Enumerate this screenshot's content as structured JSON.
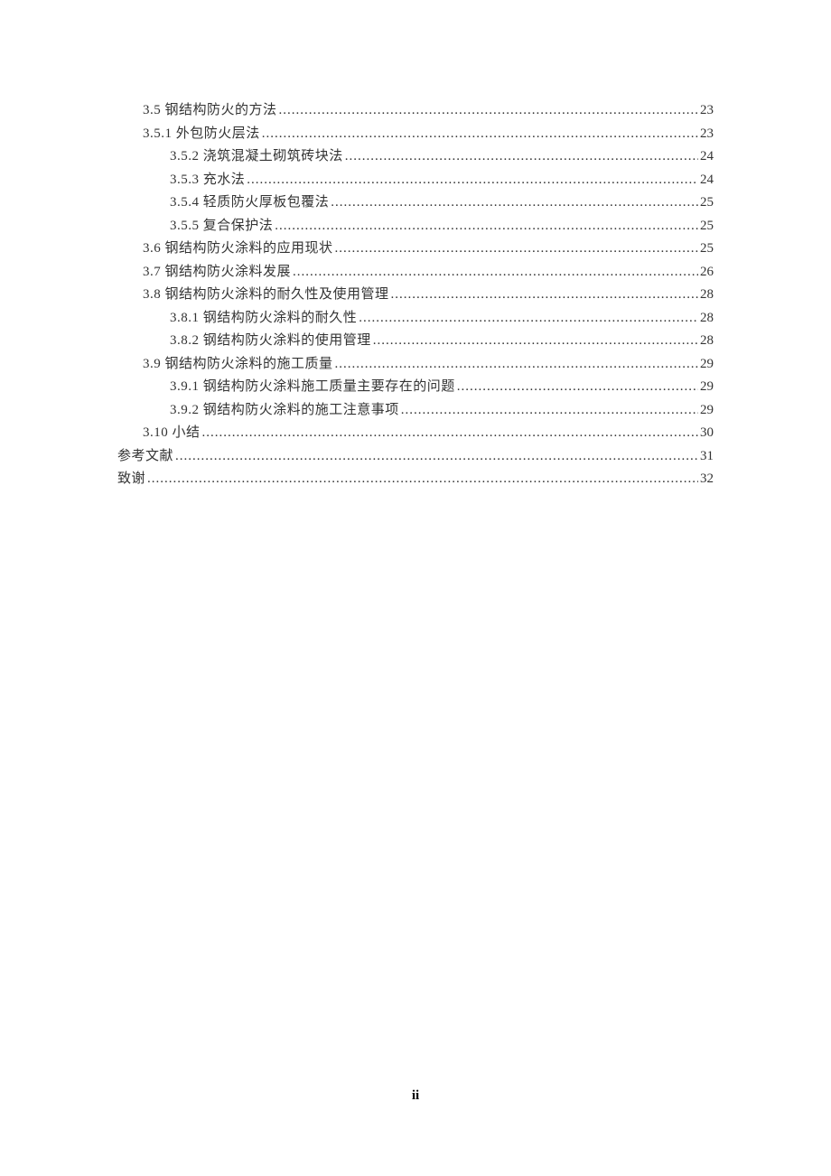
{
  "toc": [
    {
      "level": 1,
      "label": "3.5 钢结构防火的方法",
      "page": "23"
    },
    {
      "level": 1,
      "label": "3.5.1 外包防火层法",
      "page": "23"
    },
    {
      "level": 2,
      "label": "3.5.2 浇筑混凝土砌筑砖块法",
      "page": "24"
    },
    {
      "level": 2,
      "label": "3.5.3 充水法",
      "page": "24"
    },
    {
      "level": 2,
      "label": "3.5.4 轻质防火厚板包覆法",
      "page": "25"
    },
    {
      "level": 2,
      "label": "3.5.5 复合保护法",
      "page": "25"
    },
    {
      "level": 1,
      "label": "3.6 钢结构防火涂料的应用现状",
      "page": "25"
    },
    {
      "level": 1,
      "label": "3.7 钢结构防火涂料发展",
      "page": "26"
    },
    {
      "level": 1,
      "label": "3.8 钢结构防火涂料的耐久性及使用管理",
      "page": "28"
    },
    {
      "level": 2,
      "label": "3.8.1 钢结构防火涂料的耐久性",
      "page": "28"
    },
    {
      "level": 2,
      "label": "3.8.2 钢结构防火涂料的使用管理",
      "page": "28"
    },
    {
      "level": 1,
      "label": "3.9 钢结构防火涂料的施工质量",
      "page": "29"
    },
    {
      "level": 2,
      "label": "3.9.1 钢结构防火涂料施工质量主要存在的问题",
      "page": "29"
    },
    {
      "level": 2,
      "label": "3.9.2 钢结构防火涂料的施工注意事项",
      "page": "29"
    },
    {
      "level": 1,
      "label": "3.10 小结",
      "page": "30"
    },
    {
      "level": 0,
      "label": "参考文献",
      "page": "31"
    },
    {
      "level": 0,
      "label": "致谢",
      "page": "32"
    }
  ],
  "page_number": "ii"
}
